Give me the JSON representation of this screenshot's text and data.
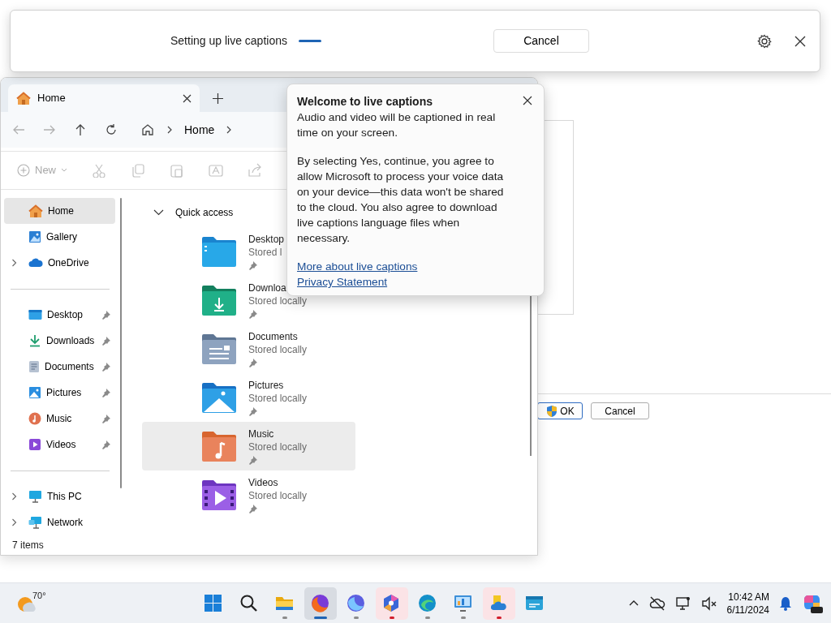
{
  "caption_bar": {
    "status": "Setting up live captions",
    "cancel": "Cancel"
  },
  "dialog": {
    "buttons": [
      {
        "label": "OK",
        "kind": "shield",
        "default": true
      },
      {
        "label": "Cancel",
        "kind": "plain",
        "default": false
      }
    ]
  },
  "explorer": {
    "tab": {
      "label": "Home",
      "selected": true
    },
    "address": [
      "Home"
    ],
    "new_button": {
      "label": "New",
      "disabled": true
    },
    "sidebar": {
      "groups": [
        [
          {
            "label": "Home",
            "kind": "home",
            "selected": true,
            "pinned": false,
            "expandable": false
          },
          {
            "label": "Gallery",
            "kind": "gallery",
            "selected": false,
            "pinned": false,
            "expandable": false
          },
          {
            "label": "OneDrive",
            "kind": "cloud",
            "selected": false,
            "pinned": false,
            "expandable": true
          }
        ],
        [
          {
            "label": "Desktop",
            "kind": "desktop",
            "selected": false,
            "pinned": true,
            "expandable": false
          },
          {
            "label": "Downloads",
            "kind": "downloads",
            "selected": false,
            "pinned": true,
            "expandable": false
          },
          {
            "label": "Documents",
            "kind": "documents",
            "selected": false,
            "pinned": true,
            "expandable": false
          },
          {
            "label": "Pictures",
            "kind": "pictures",
            "selected": false,
            "pinned": true,
            "expandable": false
          },
          {
            "label": "Music",
            "kind": "music",
            "selected": false,
            "pinned": true,
            "expandable": false
          },
          {
            "label": "Videos",
            "kind": "videos",
            "selected": false,
            "pinned": true,
            "expandable": false
          }
        ],
        [
          {
            "label": "This PC",
            "kind": "pc",
            "selected": false,
            "pinned": false,
            "expandable": true
          },
          {
            "label": "Network",
            "kind": "network",
            "selected": false,
            "pinned": false,
            "expandable": true
          }
        ]
      ]
    },
    "section": {
      "label": "Quick access",
      "expanded": true
    },
    "items": [
      {
        "name": "Desktop",
        "detail": "Stored l",
        "kind": "desktop",
        "selected": false,
        "pinned": true
      },
      {
        "name": "Downloa",
        "detail": "Stored locally",
        "kind": "downloads",
        "selected": false,
        "pinned": true
      },
      {
        "name": "Documents",
        "detail": "Stored locally",
        "kind": "documents",
        "selected": false,
        "pinned": true
      },
      {
        "name": "Pictures",
        "detail": "Stored locally",
        "kind": "pictures",
        "selected": false,
        "pinned": true
      },
      {
        "name": "Music",
        "detail": "Stored locally",
        "kind": "music",
        "selected": true,
        "pinned": true
      },
      {
        "name": "Videos",
        "detail": "Stored locally",
        "kind": "videos",
        "selected": false,
        "pinned": true
      }
    ],
    "status": "7 items"
  },
  "popup": {
    "title": "Welcome to live captions",
    "paragraphs": [
      "Audio and video will be captioned in real time on your screen.",
      "By selecting Yes, continue, you agree to allow Microsoft to process your voice data on your device—this data won't be shared to the cloud. You also agree to download live captions language files when necessary."
    ],
    "links": [
      "More about live captions",
      "Privacy Statement"
    ]
  },
  "taskbar": {
    "weather": "70°",
    "apps": [
      {
        "kind": "start",
        "running": false,
        "focused": false,
        "flashing": false
      },
      {
        "kind": "search",
        "running": false,
        "focused": false,
        "flashing": false
      },
      {
        "kind": "folder",
        "running": true,
        "focused": false,
        "flashing": false
      },
      {
        "kind": "browser",
        "running": true,
        "focused": true,
        "flashing": false
      },
      {
        "kind": "browser2",
        "running": true,
        "focused": false,
        "flashing": false
      },
      {
        "kind": "swirl",
        "running": true,
        "focused": false,
        "flashing": true
      },
      {
        "kind": "wave",
        "running": true,
        "focused": false,
        "flashing": false
      },
      {
        "kind": "monitor",
        "running": true,
        "focused": false,
        "flashing": false
      },
      {
        "kind": "cloudapp",
        "running": true,
        "focused": false,
        "flashing": true
      },
      {
        "kind": "captions",
        "running": false,
        "focused": false,
        "flashing": false
      }
    ],
    "time": "10:42 AM",
    "date": "6/11/2024"
  }
}
